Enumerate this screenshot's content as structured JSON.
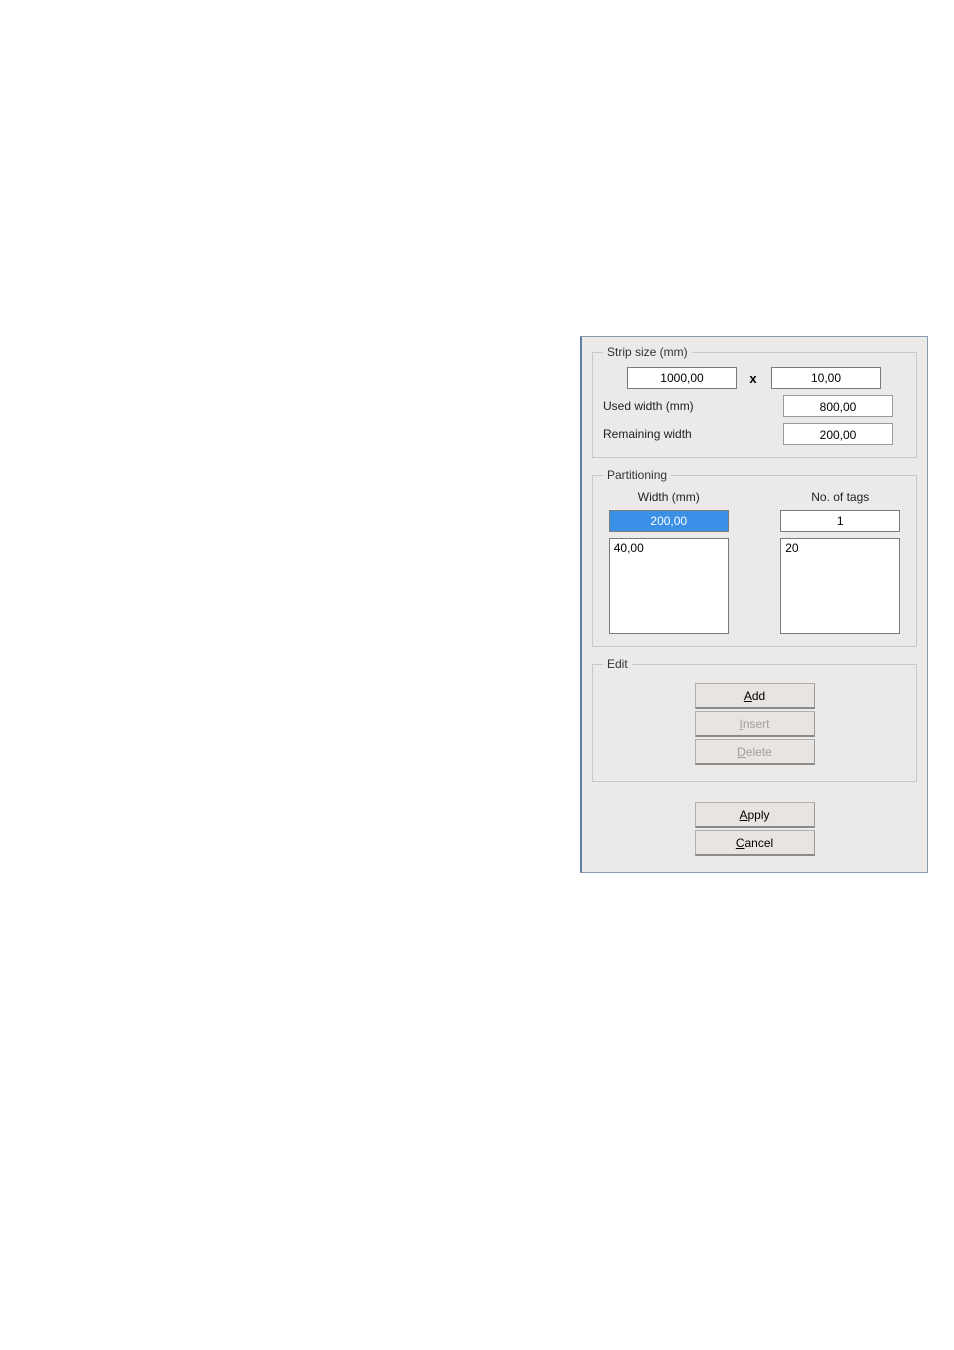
{
  "strip_size": {
    "legend": "Strip size (mm)",
    "width_value": "1000,00",
    "x_label": "x",
    "height_value": "10,00",
    "used_width_label": "Used width (mm)",
    "used_width_value": "800,00",
    "remaining_width_label": "Remaining width",
    "remaining_width_value": "200,00"
  },
  "partitioning": {
    "legend": "Partitioning",
    "width_header": "Width (mm)",
    "tags_header": "No. of tags",
    "width_input": "200,00",
    "tags_input": "1",
    "width_list_item": "40,00",
    "tags_list_item": "20"
  },
  "edit": {
    "legend": "Edit",
    "add": "dd",
    "add_mn": "A",
    "insert": "nsert",
    "insert_mn": "I",
    "delete": "elete",
    "delete_mn": "D"
  },
  "footer": {
    "apply": "pply",
    "apply_mn": "A",
    "cancel": "ancel",
    "cancel_mn": "C"
  }
}
